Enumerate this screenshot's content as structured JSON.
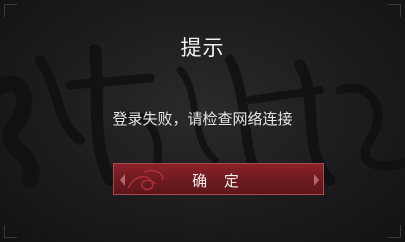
{
  "dialog": {
    "title": "提示",
    "message": "登录失败，请检查网络连接",
    "confirm_label": "确 定"
  },
  "colors": {
    "background": "#1c1c1e",
    "button_fill": "#6e1b20",
    "button_border": "#a84a4f",
    "text": "#f2f2f2"
  },
  "icons": {
    "background_art": "calligraphy-brush-strokes",
    "button_ornament": "red-swirl-ornament"
  }
}
